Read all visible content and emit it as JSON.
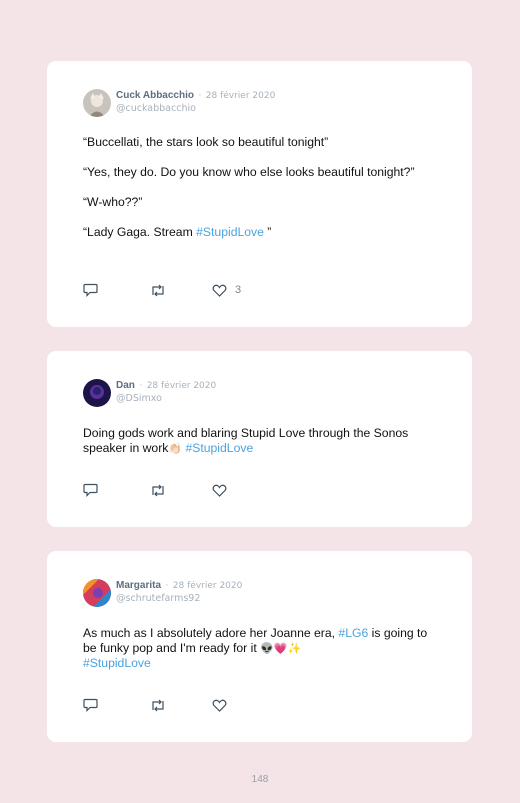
{
  "tweets": [
    {
      "name": "Cuck Abbacchio",
      "separator": "·",
      "date": "28 février 2020",
      "handle": "@cuckabbacchio",
      "paragraphs": [
        "“Buccellati, the stars look so beautiful tonight”",
        "“Yes, they do. Do you know who else looks beautiful tonight?”",
        "“W-who??”"
      ],
      "last_before": "“Lady Gaga. Stream ",
      "last_tag": "#StupidLove",
      "last_after": " ”",
      "like_count": "3"
    },
    {
      "name": "Dan",
      "separator": "·",
      "date": "28 février 2020",
      "handle": "@DSimxo",
      "text": "Doing gods work and blaring Stupid Love through the Sonos speaker in work",
      "emoji": "👏🏻",
      "tag": "#StupidLove"
    },
    {
      "name": "Margarita",
      "separator": "·",
      "date": "28 février 2020",
      "handle": "@schrutefarms92",
      "text_before": "As much as I absolutely adore her Joanne era, ",
      "tag1": "#LG6",
      "text_middle": " is going to be funky pop and I'm ready for it ",
      "emojis": "👽💗✨",
      "tag2": "#StupidLove"
    }
  ],
  "page_number": "148",
  "colors": {
    "background": "#f4e3e7",
    "card": "#ffffff",
    "hashtag": "#4aa3df",
    "name": "#5b6f82",
    "muted": "#a7b1bb"
  },
  "icons": [
    "reply-icon",
    "retweet-icon",
    "like-icon"
  ]
}
